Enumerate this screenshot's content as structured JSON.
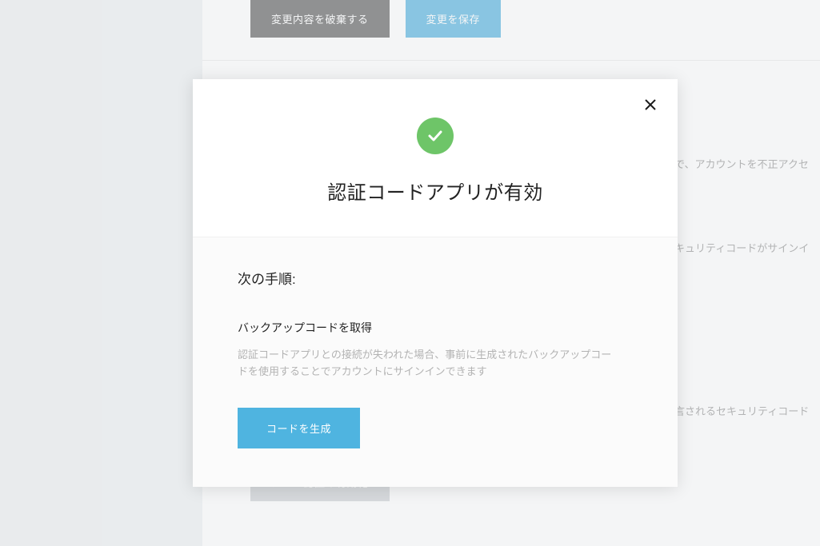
{
  "buttons": {
    "discard": "変更内容を破棄する",
    "save": "変更を保存",
    "email_auth": "メール認証の有効化"
  },
  "background": {
    "text1": "で、アカウントを不正アクセ",
    "text2": "キュリティコードがサインイ",
    "text3": "言されるセキュリティコード"
  },
  "modal": {
    "title": "認証コードアプリが有効",
    "next_steps": "次の手順:",
    "backup_title": "バックアップコードを取得",
    "backup_desc": "認証コードアプリとの接続が失われた場合、事前に生成されたバックアップコードを使用することでアカウントにサインインできます",
    "generate": "コードを生成"
  }
}
